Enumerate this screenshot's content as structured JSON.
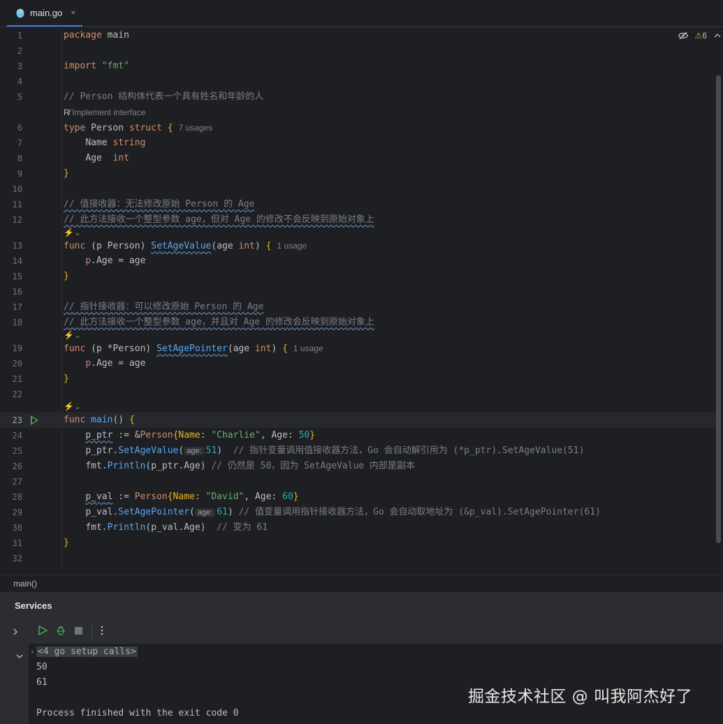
{
  "tab": {
    "filename": "main.go",
    "close": "×"
  },
  "status": {
    "warnings": "6"
  },
  "colors": {
    "accent": "#3574f0",
    "run": "#499c54",
    "keyword": "#cf8e6d",
    "string": "#6aab73",
    "number": "#2aacb8",
    "function": "#56a8f5"
  },
  "icons": {
    "tab": "go-gopher-icon",
    "run": "run-icon",
    "debug": "debug-icon",
    "stop": "stop-icon",
    "more": "more-vertical-icon",
    "reader_mode": "eye-slash-icon",
    "warning": "warning-icon",
    "expand": "chevron-right-icon",
    "collapse": "chevron-down-icon",
    "implement": "implement-interface-icon",
    "ai": "ai-action-icon"
  },
  "lines": {
    "l1": "package",
    "l1b": "main",
    "l3": "import",
    "l3b": "\"fmt\"",
    "l5": "// Person 结构体代表一个具有姓名和年龄的人",
    "hint_impl": "Implement interface",
    "l6a": "type",
    "l6b": "Person",
    "l6c": "struct",
    "l6d": "{",
    "l6u": "7 usages",
    "l7a": "Name",
    "l7b": "string",
    "l8a": "Age",
    "l8b": "int",
    "l9": "}",
    "l11": "// 值接收器：无法修改原始 Person 的 Age",
    "l12": "// 此方法接收一个整型参数 age，但对 Age 的修改不会反映到原始对象上",
    "l13a": "func",
    "l13b": "(p Person)",
    "l13c": "SetAgeValue",
    "l13d": "(age",
    "l13e": "int",
    "l13f": ")",
    "l13g": "{",
    "l13u": "1 usage",
    "l14a": "p",
    "l14b": ".Age = age",
    "l15": "}",
    "l17": "// 指针接收器：可以修改原始 Person 的 Age",
    "l18": "// 此方法接收一个整型参数 age，并且对 Age 的修改会反映到原始对象上",
    "l19a": "func",
    "l19b": "(p *Person)",
    "l19c": "SetAgePointer",
    "l19d": "(age",
    "l19e": "int",
    "l19f": ")",
    "l19g": "{",
    "l19u": "1 usage",
    "l20a": "p",
    "l20b": ".Age = age",
    "l21": "}",
    "l23a": "func",
    "l23b": "main",
    "l23c": "()",
    "l23d": "{",
    "l24a": "p_ptr",
    "l24b": " := &",
    "l24c": "Person",
    "l24d": "{Name: ",
    "l24e": "\"Charlie\"",
    "l24f": ", Age: ",
    "l24g": "50",
    "l24h": "}",
    "l25a": "p_ptr",
    "l25b": ".",
    "l25c": "SetAgeValue",
    "l25d": "(",
    "l25i": "age:",
    "l25e": "51",
    "l25f": ")  ",
    "l25g": "// 指针变量调用值接收器方法，Go 会自动解引用为 (*p_ptr).SetAgeValue(51)",
    "l26a": "fmt",
    "l26b": ".",
    "l26c": "Println",
    "l26d": "(p_ptr.Age) ",
    "l26e": "// 仍然是 50，因为 SetAgeValue 内部是副本",
    "l28a": "p_val",
    "l28b": " := ",
    "l28c": "Person",
    "l28d": "{Name: ",
    "l28e": "\"David\"",
    "l28f": ", Age: ",
    "l28g": "60",
    "l28h": "}",
    "l29a": "p_val",
    "l29b": ".",
    "l29c": "SetAgePointer",
    "l29d": "(",
    "l29i": "age:",
    "l29e": "61",
    "l29f": ") ",
    "l29g": "// 值变量调用指针接收器方法，Go 会自动取地址为 (&p_val).SetAgePointer(61)",
    "l30a": "fmt",
    "l30b": ".",
    "l30c": "Println",
    "l30d": "(p_val.Age)  ",
    "l30e": "// 变为 61",
    "l31": "}"
  },
  "breadcrumb": "main()",
  "services": {
    "title": "Services",
    "setup": "<4 go setup calls>",
    "out1": "50",
    "out2": "61",
    "exit": "Process finished with the exit code 0"
  },
  "watermark": "掘金技术社区 @ 叫我阿杰好了"
}
